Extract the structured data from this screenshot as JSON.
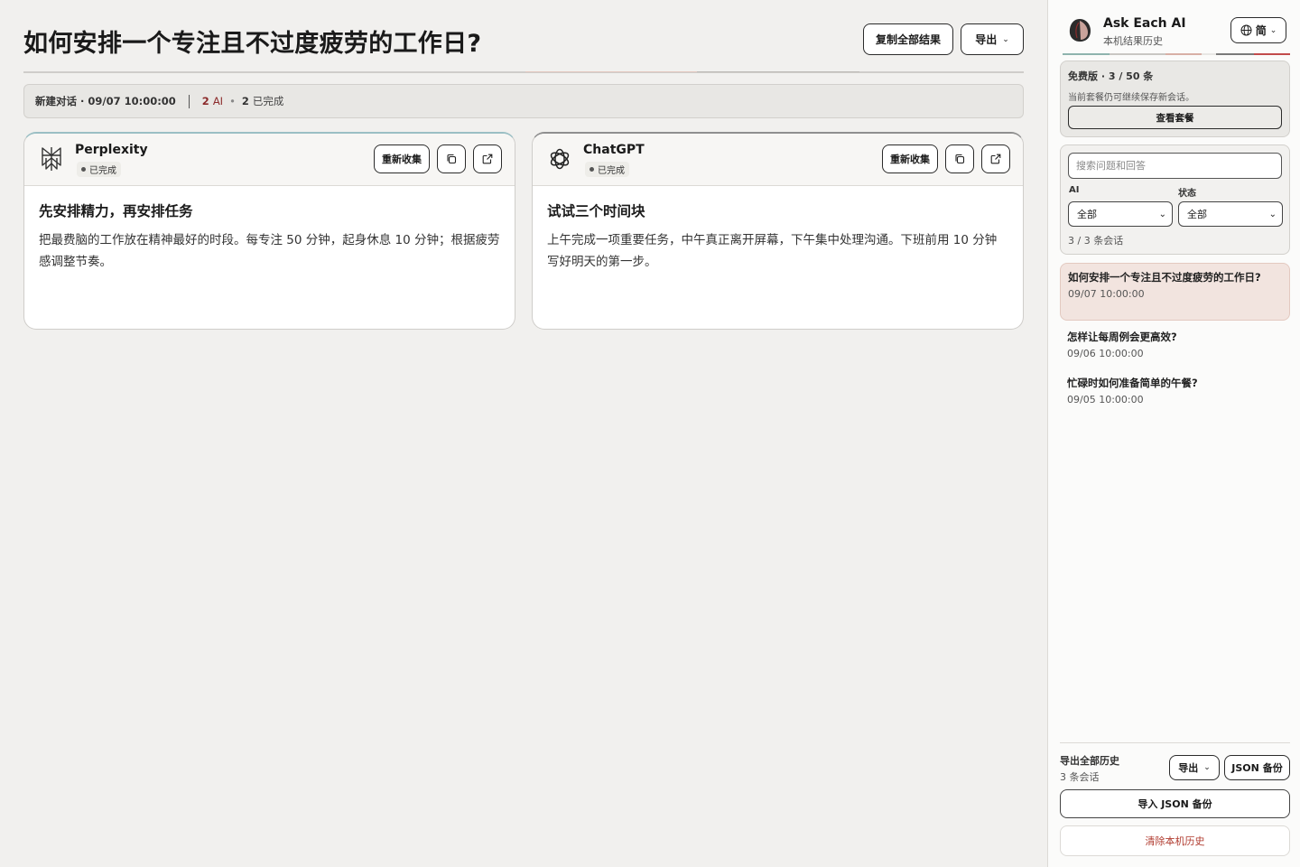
{
  "main": {
    "title": "如何安排一个专注且不过度疲劳的工作日?",
    "copy_all_label": "复制全部结果",
    "export_label": "导出",
    "status": {
      "conversation": "新建对话 · 09/07 10:00:00",
      "ai_count": "2",
      "ai_label": "AI",
      "done_count": "2",
      "done_label": "已完成"
    },
    "cards": [
      {
        "ai_name": "Perplexity",
        "status": "已完成",
        "recollect_label": "重新收集",
        "answer_title": "先安排精力，再安排任务",
        "answer_text": "把最费脑的工作放在精神最好的时段。每专注 50 分钟，起身休息 10 分钟；根据疲劳感调整节奏。"
      },
      {
        "ai_name": "ChatGPT",
        "status": "已完成",
        "recollect_label": "重新收集",
        "answer_title": "试试三个时间块",
        "answer_text": "上午完成一项重要任务，中午真正离开屏幕，下午集中处理沟通。下班前用 10 分钟写好明天的第一步。"
      }
    ]
  },
  "sidebar": {
    "app_title": "Ask Each AI",
    "app_subtitle": "本机结果历史",
    "lang_label": "简",
    "plan": {
      "title": "免费版 · 3 / 50 条",
      "desc": "当前套餐仍可继续保存新会话。",
      "button": "查看套餐"
    },
    "search_placeholder": "搜索问题和回答",
    "filter_ai_label": "AI",
    "filter_ai_value": "全部",
    "filter_status_label": "状态",
    "filter_status_value": "全部",
    "count": "3 / 3 条会话",
    "history": [
      {
        "question": "如何安排一个专注且不过度疲劳的工作日?",
        "time": "09/07 10:00:00"
      },
      {
        "question": "怎样让每周例会更高效?",
        "time": "09/06 10:00:00"
      },
      {
        "question": "忙碌时如何准备简单的午餐?",
        "time": "09/05 10:00:00"
      }
    ],
    "export_all_title": "导出全部历史",
    "export_all_count": "3 条会话",
    "export_label": "导出",
    "json_backup_label": "JSON 备份",
    "import_label": "导入 JSON 备份",
    "clear_label": "清除本机历史"
  },
  "colors": {
    "accent_red": "#8c2b2b",
    "active_history_bg": "#f2e4df",
    "clear_red": "#b03a2e"
  },
  "icons": [
    "perplexity-logo-icon",
    "chatgpt-logo-icon",
    "copy-icon",
    "external-link-icon",
    "globe-icon",
    "chevron-down-icon",
    "avatar-icon"
  ]
}
